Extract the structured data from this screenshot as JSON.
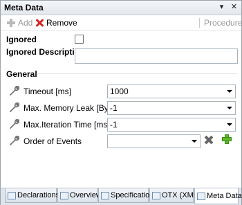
{
  "window": {
    "title": "Meta Data"
  },
  "title_buttons": {
    "pin": "▾",
    "close": "✕"
  },
  "toolbar": {
    "add_label": "Add",
    "remove_label": "Remove",
    "procedure_label": "Procedure"
  },
  "fields": {
    "ignored_label": "Ignored",
    "ignored_checked": false,
    "ignored_description_label": "Ignored Description",
    "ignored_description_value": ""
  },
  "general": {
    "section_label": "General",
    "timeout_label": "Timeout [ms]",
    "timeout_value": "1000",
    "max_memory_label": "Max. Memory Leak [Byte/s]",
    "max_memory_value": "-1",
    "max_iteration_label": "Max.Iteration Time [ms]",
    "max_iteration_value": "-1",
    "order_label": "Order of Events",
    "order_value": ""
  },
  "tabs": [
    {
      "label": "Declarations",
      "active": false
    },
    {
      "label": "Overview",
      "active": false
    },
    {
      "label": "Specification",
      "active": false
    },
    {
      "label": "OTX (XML)",
      "active": false
    },
    {
      "label": "Meta Data",
      "active": true
    }
  ]
}
